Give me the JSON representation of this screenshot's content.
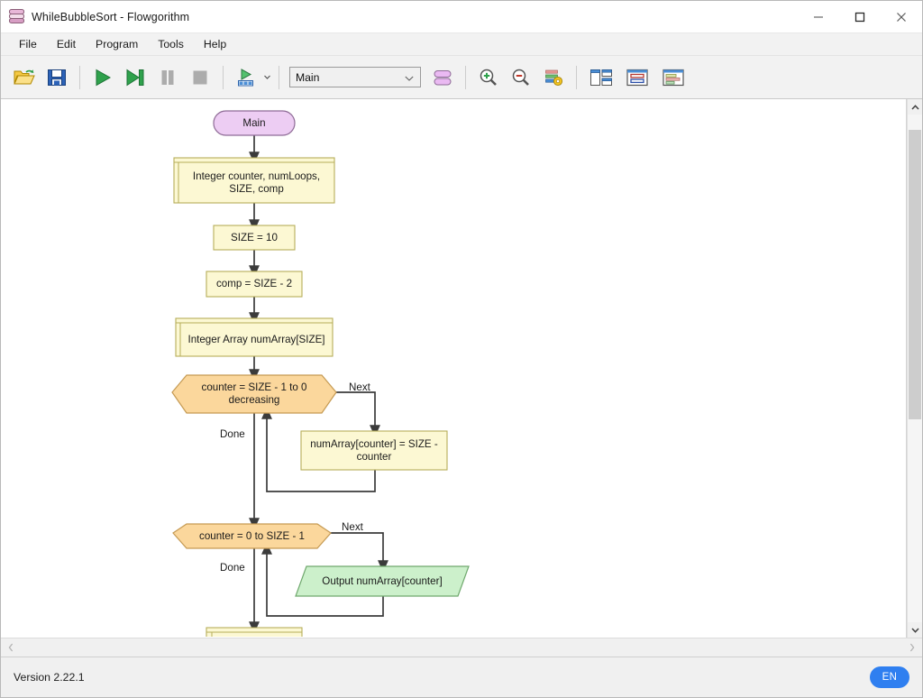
{
  "window": {
    "title": "WhileBubbleSort - Flowgorithm",
    "icon": "flowgorithm-stack-icon",
    "controls": {
      "minimize": "minimize-icon",
      "maximize": "maximize-icon",
      "close": "close-icon"
    }
  },
  "menubar": {
    "items": [
      {
        "label": "File"
      },
      {
        "label": "Edit"
      },
      {
        "label": "Program"
      },
      {
        "label": "Tools"
      },
      {
        "label": "Help"
      }
    ]
  },
  "toolbar": {
    "buttons": [
      {
        "name": "open-file-button",
        "icon": "folder-open-icon",
        "title": "Open"
      },
      {
        "name": "save-file-button",
        "icon": "floppy-disk-save-icon",
        "title": "Save"
      },
      {
        "name": "run-button",
        "icon": "play-triangle-icon",
        "title": "Run"
      },
      {
        "name": "step-button",
        "icon": "step-forward-icon",
        "title": "Step"
      },
      {
        "name": "pause-button",
        "icon": "pause-bars-icon",
        "title": "Pause"
      },
      {
        "name": "stop-button",
        "icon": "stop-square-icon",
        "title": "Stop"
      },
      {
        "name": "generate-code-button",
        "icon": "run-code-blocks-icon",
        "title": "Generate Code"
      },
      {
        "name": "function-chart-button",
        "icon": "two-pill-stack-icon",
        "title": "Functions"
      },
      {
        "name": "zoom-in-button",
        "icon": "magnifier-plus-icon",
        "title": "Zoom In"
      },
      {
        "name": "zoom-out-button",
        "icon": "magnifier-minus-icon",
        "title": "Zoom Out"
      },
      {
        "name": "chart-settings-button",
        "icon": "bars-gear-icon",
        "title": "Chart Settings"
      },
      {
        "name": "split-view-button",
        "icon": "panel-split-icon",
        "title": "Split View"
      },
      {
        "name": "variable-watch-button",
        "icon": "window-red-blue-icon",
        "title": "Variable Watch"
      },
      {
        "name": "console-view-button",
        "icon": "window-list-icon",
        "title": "Console"
      }
    ],
    "dropdown": {
      "name": "function-selector",
      "value": "Main",
      "caret": "chevron-down-icon"
    }
  },
  "scrollbars": {
    "vertical": {
      "up": "chevron-up-icon",
      "down": "chevron-down-icon",
      "thumb_top_pct": 3,
      "thumb_height_pct": 57
    },
    "horizontal": {
      "left": "chevron-left-icon",
      "right": "chevron-right-icon"
    }
  },
  "statusbar": {
    "version": "Version 2.22.1",
    "language_badge": "EN"
  },
  "flowchart": {
    "colors": {
      "terminal_fill": "#edcdf3",
      "terminal_stroke": "#8e6b96",
      "statement_fill": "#fcf8d3",
      "statement_stroke": "#b6ae5a",
      "loop_fill": "#fbd79c",
      "loop_stroke": "#c59a53",
      "output_fill": "#ccf0cb",
      "output_stroke": "#6fa86d",
      "connector": "#3b3b3b"
    },
    "nodes": [
      {
        "id": "main",
        "type": "terminal",
        "label": "Main"
      },
      {
        "id": "decl1",
        "type": "declaration",
        "label": "Integer counter, numLoops, SIZE, comp"
      },
      {
        "id": "assign-size",
        "type": "assignment",
        "label": "SIZE = 10"
      },
      {
        "id": "assign-comp",
        "type": "assignment",
        "label": "comp = SIZE - 2"
      },
      {
        "id": "decl2",
        "type": "declaration",
        "label": "Integer Array numArray[SIZE]"
      },
      {
        "id": "loop1",
        "type": "loop",
        "label": "counter = SIZE - 1 to 0 decreasing"
      },
      {
        "id": "assign-fill",
        "type": "assignment",
        "label": "numArray[counter] = SIZE - counter"
      },
      {
        "id": "loop2",
        "type": "loop",
        "label": "counter = 0 to SIZE - 1"
      },
      {
        "id": "output1",
        "type": "output",
        "label": "Output numArray[counter]"
      },
      {
        "id": "decl3",
        "type": "declaration",
        "label": ""
      }
    ],
    "edge_labels": [
      {
        "id": "loop1-next",
        "text": "Next"
      },
      {
        "id": "loop1-done",
        "text": "Done"
      },
      {
        "id": "loop2-next",
        "text": "Next"
      },
      {
        "id": "loop2-done",
        "text": "Done"
      }
    ]
  }
}
